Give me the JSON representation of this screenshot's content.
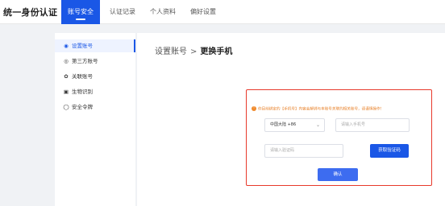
{
  "header": {
    "brand": "统一身份认证",
    "tabs": [
      {
        "label": "账号安全",
        "active": true
      },
      {
        "label": "认证记录",
        "active": false
      },
      {
        "label": "个人资料",
        "active": false
      },
      {
        "label": "偏好设置",
        "active": false
      }
    ]
  },
  "sidebar": {
    "items": [
      {
        "label": "设置账号",
        "icon": "user-icon",
        "active": true
      },
      {
        "label": "第三方账号",
        "icon": "link-circle-icon",
        "active": false
      },
      {
        "label": "关联账号",
        "icon": "gear-icon",
        "active": false
      },
      {
        "label": "生物识别",
        "icon": "fingerprint-icon",
        "active": false
      },
      {
        "label": "安全令牌",
        "icon": "shield-icon",
        "active": false
      }
    ]
  },
  "breadcrumb": {
    "parent": "设置账号",
    "separator": ">",
    "current": "更换手机"
  },
  "form": {
    "notice": "你目前绑定的【手机号】内容会解绑与本账号关联的相关账号，请谨慎操作！",
    "country_select": "中国大陆 +86",
    "phone_placeholder": "请输入手机号",
    "code_placeholder": "请输入验证码",
    "get_code_label": "获取验证码",
    "confirm_label": "确认"
  },
  "colors": {
    "primary": "#1a57e6",
    "warning_border": "#e8392b",
    "notice_text": "#e8822b"
  }
}
